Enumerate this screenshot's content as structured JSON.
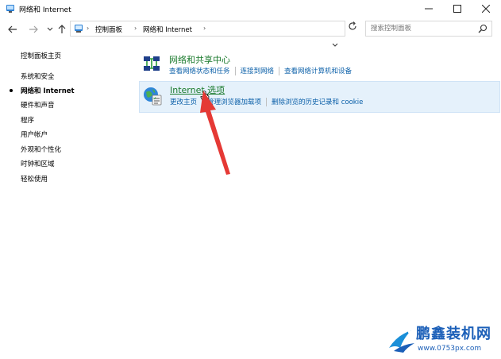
{
  "window": {
    "title": "网络和 Internet"
  },
  "address": {
    "crumbs": [
      "控制面板",
      "网络和 Internet"
    ],
    "search_placeholder": "搜索控制面板"
  },
  "leftnav": {
    "home": "控制面板主页",
    "items": [
      {
        "label": "系统和安全",
        "active": false
      },
      {
        "label": "网络和 Internet",
        "active": true
      },
      {
        "label": "硬件和声音",
        "active": false
      },
      {
        "label": "程序",
        "active": false
      },
      {
        "label": "用户帐户",
        "active": false
      },
      {
        "label": "外观和个性化",
        "active": false
      },
      {
        "label": "时钟和区域",
        "active": false
      },
      {
        "label": "轻松使用",
        "active": false
      }
    ]
  },
  "categories": {
    "network_center": {
      "title": "网络和共享中心",
      "links": [
        "查看网络状态和任务",
        "连接到网络",
        "查看网络计算机和设备"
      ]
    },
    "internet_options": {
      "title": "Internet 选项",
      "links": [
        "更改主页",
        "管理浏览器加载项",
        "删除浏览的历史记录和 cookie"
      ]
    }
  },
  "watermark": {
    "brand": "鹏鑫装机网",
    "url": "www.0753px.com"
  },
  "colors": {
    "category_title": "#1a7a2c",
    "link": "#0a5fa8",
    "highlight_bg": "#e5f1fb",
    "arrow": "#e53935"
  }
}
